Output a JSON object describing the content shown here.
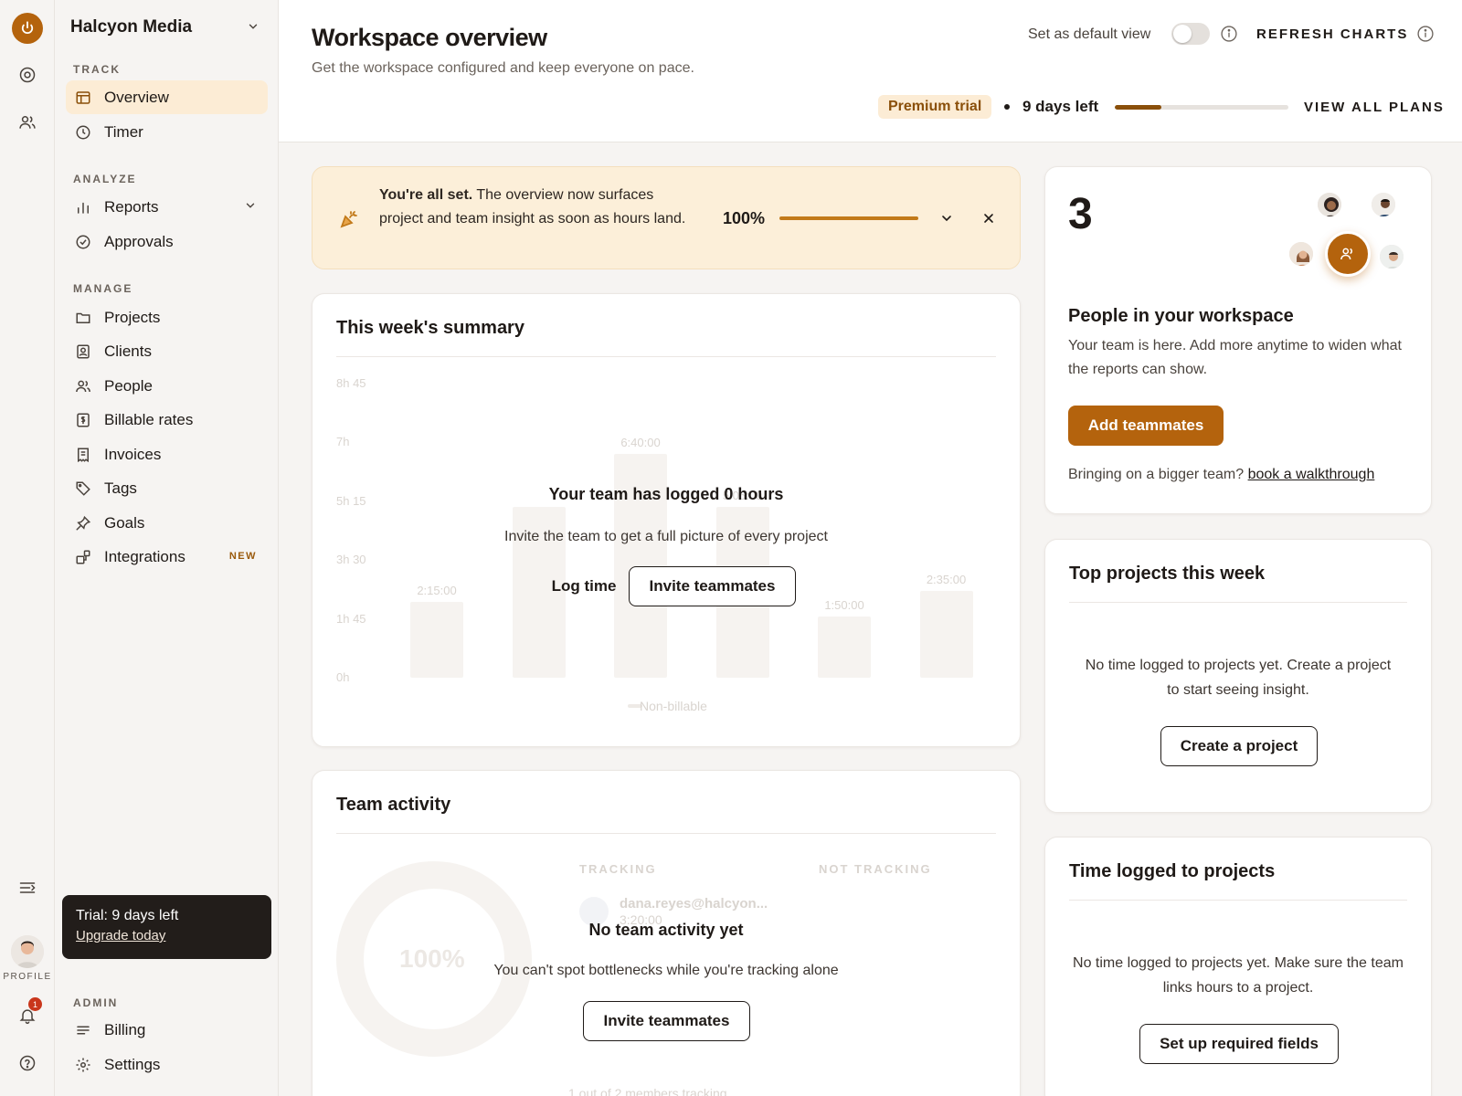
{
  "rail": {
    "profile_label": "PROFILE",
    "notification_count": "1"
  },
  "sidebar": {
    "workspace_name": "Halcyon Media",
    "sections": {
      "track": "TRACK",
      "analyze": "ANALYZE",
      "manage": "MANAGE",
      "admin": "ADMIN"
    },
    "items": {
      "overview": "Overview",
      "timer": "Timer",
      "reports": "Reports",
      "approvals": "Approvals",
      "projects": "Projects",
      "clients": "Clients",
      "people": "People",
      "billable_rates": "Billable rates",
      "invoices": "Invoices",
      "tags": "Tags",
      "goals": "Goals",
      "integrations": "Integrations",
      "billing": "Billing",
      "settings": "Settings"
    },
    "new_badge": "NEW",
    "trial": {
      "title": "Trial: 9 days left",
      "link": "Upgrade today"
    }
  },
  "header": {
    "title": "Workspace overview",
    "subtitle": "Get the workspace configured and keep everyone on pace.",
    "default_view_label": "Set as default view",
    "refresh_label": "REFRESH CHARTS",
    "trial_pill": "Premium trial",
    "days_left": "9 days left",
    "trial_progress": 0.27,
    "view_plans": "VIEW ALL PLANS"
  },
  "banner": {
    "bold": "You're all set.",
    "text": " The overview now surfaces project and team insight as soon as hours land.",
    "percent": "100%"
  },
  "summary": {
    "title": "This week's summary",
    "y_ticks": [
      "8h 45",
      "7h",
      "5h 15",
      "3h 30",
      "1h 45",
      "0h"
    ],
    "bars": [
      "2:15:00",
      "",
      "6:40:00",
      "5:05:00",
      "1:50:00",
      "2:35:00"
    ],
    "legend": "Non-billable",
    "empty_title": "Your team has logged 0 hours",
    "empty_sub": "Invite the team to get a full picture of every project",
    "log_time": "Log time",
    "invite": "Invite teammates"
  },
  "activity": {
    "title": "Team activity",
    "tracking": "TRACKING",
    "not_tracking": "NOT TRACKING",
    "donut_label": "100%",
    "member_email": "dana.reyes@halcyon...",
    "member_time": "3:20:00",
    "footer": "1 out of 2 members tracking",
    "empty_title": "No team activity yet",
    "empty_sub": "You can't spot bottlenecks while you're tracking alone",
    "invite": "Invite teammates"
  },
  "people": {
    "count": "3",
    "title": "People in your workspace",
    "text": "Your team is here. Add more anytime to widen what the reports can show.",
    "add_button": "Add teammates",
    "bigger_team": "Bringing on a bigger team?",
    "walkthrough": "book a walkthrough"
  },
  "top_projects": {
    "title": "Top projects this week",
    "text": "No time logged to projects yet. Create a project to start seeing insight.",
    "button": "Create a project"
  },
  "time_projects": {
    "title": "Time logged to projects",
    "text": "No time logged to projects yet. Make sure the team links hours to a project.",
    "button": "Set up required fields"
  },
  "colors": {
    "accent": "#b4630d",
    "accent_light": "#fcecd5",
    "dark": "#221d1a"
  }
}
